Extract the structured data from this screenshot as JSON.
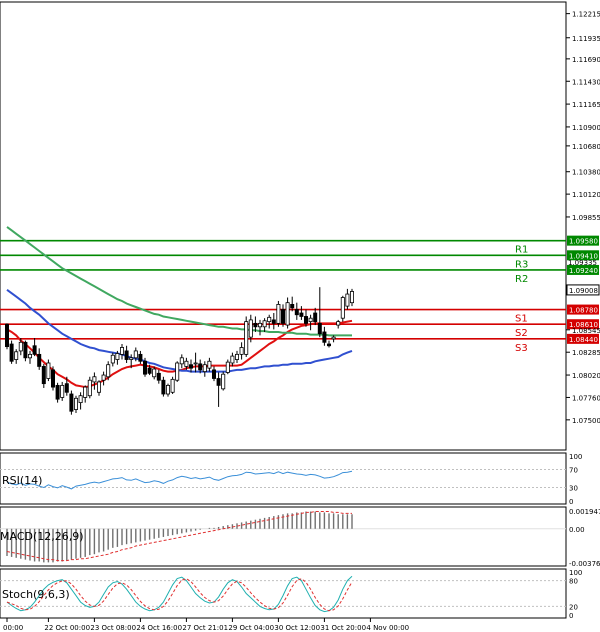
{
  "chart_data": {
    "type": "candlestick",
    "price_axis": {
      "ylim": [
        1.0715,
        1.1235
      ],
      "ticks": [
        "1.12215",
        "1.11935",
        "1.11690",
        "1.11430",
        "1.11165",
        "1.10900",
        "1.10680",
        "1.10380",
        "1.10120",
        "1.09855",
        "1.08545",
        "1.08285",
        "1.08020",
        "1.07760",
        "1.07500"
      ]
    },
    "time_axis": {
      "labels": [
        "00:00",
        "22 Oct 00:00",
        "23 Oct 08:00",
        "24 Oct 16:00",
        "27 Oct 21:01",
        "29 Oct 04:00",
        "30 Oct 12:00",
        "31 Oct 20:00",
        "4 Nov 00:00"
      ],
      "label_bars": [
        0,
        9,
        19,
        29,
        39,
        49,
        59,
        69,
        79
      ]
    },
    "candles": [
      [
        1.0861,
        1.0862,
        1.0832,
        1.0835
      ],
      [
        1.0838,
        1.0842,
        1.0815,
        1.0818
      ],
      [
        1.082,
        1.0832,
        1.0815,
        1.0829
      ],
      [
        1.083,
        1.0845,
        1.0825,
        1.084
      ],
      [
        1.084,
        1.0842,
        1.0818,
        1.0822
      ],
      [
        1.0822,
        1.083,
        1.0815,
        1.0826
      ],
      [
        1.0836,
        1.0845,
        1.0824,
        1.0826
      ],
      [
        1.0826,
        1.0833,
        1.0808,
        1.0812
      ],
      [
        1.0812,
        1.0815,
        1.0787,
        1.0792
      ],
      [
        1.0798,
        1.082,
        1.0795,
        1.0816
      ],
      [
        1.0808,
        1.0812,
        1.0784,
        1.0788
      ],
      [
        1.079,
        1.0793,
        1.077,
        1.0774
      ],
      [
        1.0776,
        1.0794,
        1.0772,
        1.079
      ],
      [
        1.0792,
        1.08,
        1.0778,
        1.0782
      ],
      [
        1.078,
        1.0784,
        1.0756,
        1.076
      ],
      [
        1.0762,
        1.0778,
        1.0758,
        1.0775
      ],
      [
        1.077,
        1.0782,
        1.0762,
        1.0778
      ],
      [
        1.0776,
        1.079,
        1.077,
        1.0788
      ],
      [
        1.0778,
        1.08,
        1.0775,
        1.0796
      ],
      [
        1.0794,
        1.0805,
        1.0785,
        1.08
      ],
      [
        1.0782,
        1.0796,
        1.0778,
        1.0794
      ],
      [
        1.0796,
        1.0806,
        1.079,
        1.0802
      ],
      [
        1.08,
        1.0818,
        1.0796,
        1.0814
      ],
      [
        1.0816,
        1.0828,
        1.0812,
        1.0825
      ],
      [
        1.082,
        1.083,
        1.0814,
        1.0827
      ],
      [
        1.0826,
        1.0838,
        1.082,
        1.0834
      ],
      [
        1.083,
        1.0836,
        1.0816,
        1.082
      ],
      [
        1.082,
        1.0826,
        1.081,
        1.0822
      ],
      [
        1.0822,
        1.0834,
        1.0818,
        1.083
      ],
      [
        1.0826,
        1.083,
        1.0815,
        1.0818
      ],
      [
        1.0818,
        1.0822,
        1.08,
        1.0803
      ],
      [
        1.081,
        1.0814,
        1.0802,
        1.0804
      ],
      [
        1.08,
        1.0812,
        1.0797,
        1.0809
      ],
      [
        1.0804,
        1.0808,
        1.0792,
        1.0796
      ],
      [
        1.0796,
        1.08,
        1.0777,
        1.078
      ],
      [
        1.078,
        1.0792,
        1.0777,
        1.079
      ],
      [
        1.0782,
        1.08,
        1.078,
        1.0797
      ],
      [
        1.0796,
        1.0818,
        1.0794,
        1.0816
      ],
      [
        1.0815,
        1.0826,
        1.081,
        1.0822
      ],
      [
        1.0812,
        1.0822,
        1.0808,
        1.0818
      ],
      [
        1.0814,
        1.082,
        1.0805,
        1.081
      ],
      [
        1.0815,
        1.0828,
        1.0805,
        1.0816
      ],
      [
        1.0815,
        1.082,
        1.0804,
        1.0808
      ],
      [
        1.0806,
        1.0818,
        1.08,
        1.0814
      ],
      [
        1.081,
        1.0822,
        1.0806,
        1.0818
      ],
      [
        1.0808,
        1.0812,
        1.0795,
        1.0798
      ],
      [
        1.0798,
        1.0805,
        1.0765,
        1.079
      ],
      [
        1.0786,
        1.0806,
        1.0784,
        1.0803
      ],
      [
        1.0805,
        1.082,
        1.0803,
        1.0817
      ],
      [
        1.0816,
        1.0828,
        1.0812,
        1.0824
      ],
      [
        1.082,
        1.083,
        1.0816,
        1.0826
      ],
      [
        1.0826,
        1.084,
        1.082,
        1.0834
      ],
      [
        1.0826,
        1.087,
        1.0823,
        1.0864
      ],
      [
        1.0846,
        1.0872,
        1.084,
        1.0866
      ],
      [
        1.0862,
        1.087,
        1.0852,
        1.0858
      ],
      [
        1.0858,
        1.0866,
        1.0848,
        1.0862
      ],
      [
        1.0858,
        1.0868,
        1.0852,
        1.0865
      ],
      [
        1.0864,
        1.0872,
        1.0856,
        1.0869
      ],
      [
        1.0866,
        1.0874,
        1.0855,
        1.0862
      ],
      [
        1.0862,
        1.0888,
        1.0858,
        1.0884
      ],
      [
        1.0878,
        1.0884,
        1.0858,
        1.0862
      ],
      [
        1.086,
        1.0892,
        1.0856,
        1.0886
      ],
      [
        1.0884,
        1.0893,
        1.0876,
        1.088
      ],
      [
        1.0878,
        1.0886,
        1.0866,
        1.0872
      ],
      [
        1.0874,
        1.0882,
        1.0866,
        1.087
      ],
      [
        1.087,
        1.0878,
        1.0858,
        1.0862
      ],
      [
        1.0864,
        1.0872,
        1.0854,
        1.0868
      ],
      [
        1.0874,
        1.088,
        1.086,
        1.0864
      ],
      [
        1.0862,
        1.0904,
        1.0846,
        1.085
      ],
      [
        1.0852,
        1.0858,
        1.0836,
        1.084
      ],
      [
        1.0838,
        1.0842,
        1.0834,
        1.0836
      ],
      [
        1.0844,
        1.0848,
        1.084,
        1.0846
      ],
      [
        1.086,
        1.0866,
        1.0856,
        1.0864
      ],
      [
        1.0868,
        1.0894,
        1.0864,
        1.0892
      ],
      [
        1.0882,
        1.0902,
        1.0878,
        1.0896
      ],
      [
        1.0886,
        1.0902,
        1.0882,
        1.0899
      ]
    ],
    "levels": [
      {
        "label": "R3",
        "value": 1.0941,
        "tag": "1.09410",
        "color": "#008800"
      },
      {
        "label": "R2",
        "value": 1.0924,
        "tag": "1.09240",
        "color": "#008800"
      },
      {
        "label": "R1",
        "value": 1.0958,
        "tag": "1.09580",
        "color": "#008800"
      },
      {
        "label": "S1",
        "value": 1.0878,
        "tag": "1.08780",
        "color": "#d40000"
      },
      {
        "label": "S2",
        "value": 1.0861,
        "tag": "1.08610",
        "color": "#d40000"
      },
      {
        "label": "S3",
        "value": 1.0844,
        "tag": "1.08440",
        "color": "#d40000"
      }
    ],
    "extra_tags": [
      "1.09335",
      "1.09020"
    ],
    "current_price": "1.09008",
    "moving_averages": [
      {
        "color": "#e01010",
        "values": [
          1.0855,
          1.0852,
          1.0848,
          1.0842,
          1.0838,
          1.0833,
          1.0828,
          1.0822,
          1.0817,
          1.0812,
          1.0808,
          1.0803,
          1.08,
          1.0797,
          1.0793,
          1.079,
          1.0789,
          1.0788,
          1.0789,
          1.0791,
          1.0793,
          1.0796,
          1.0799,
          1.0803,
          1.0806,
          1.0809,
          1.0811,
          1.0812,
          1.0813,
          1.0814,
          1.0813,
          1.0812,
          1.0811,
          1.0809,
          1.0807,
          1.0806,
          1.0806,
          1.0807,
          1.0808,
          1.081,
          1.0811,
          1.0812,
          1.0812,
          1.0812,
          1.0813,
          1.0813,
          1.0813,
          1.0813,
          1.0813,
          1.0813,
          1.0813,
          1.0814,
          1.0818,
          1.0822,
          1.0826,
          1.083,
          1.0834,
          1.0838,
          1.0841,
          1.0845,
          1.0848,
          1.0852,
          1.0855,
          1.0857,
          1.0859,
          1.086,
          1.0861,
          1.0862,
          1.0862,
          1.0862,
          1.0862,
          1.0862,
          1.0862,
          1.0863,
          1.0864,
          1.0865
        ]
      },
      {
        "color": "#3050d0",
        "values": [
          1.0901,
          1.0897,
          1.0893,
          1.0889,
          1.0885,
          1.088,
          1.0876,
          1.0872,
          1.0867,
          1.0862,
          1.0858,
          1.0854,
          1.085,
          1.0847,
          1.0844,
          1.0841,
          1.0838,
          1.0836,
          1.0834,
          1.0833,
          1.0831,
          1.083,
          1.0829,
          1.0828,
          1.0827,
          1.0826,
          1.0824,
          1.0822,
          1.0821,
          1.082,
          1.0818,
          1.0816,
          1.0815,
          1.0813,
          1.0811,
          1.081,
          1.0809,
          1.0808,
          1.0807,
          1.0807,
          1.0806,
          1.0806,
          1.0806,
          1.0806,
          1.0806,
          1.0806,
          1.0806,
          1.0806,
          1.0806,
          1.0807,
          1.0808,
          1.0808,
          1.0809,
          1.081,
          1.081,
          1.0811,
          1.0812,
          1.0812,
          1.0813,
          1.0813,
          1.0814,
          1.0814,
          1.0815,
          1.0815,
          1.0815,
          1.0816,
          1.0816,
          1.0818,
          1.0819,
          1.082,
          1.0821,
          1.0822,
          1.0823,
          1.0826,
          1.0828,
          1.083
        ]
      },
      {
        "color": "#40a860",
        "values": [
          1.0974,
          1.097,
          1.0966,
          1.0962,
          1.0958,
          1.0954,
          1.095,
          1.0946,
          1.0942,
          1.0938,
          1.0934,
          1.093,
          1.0926,
          1.0923,
          1.092,
          1.0917,
          1.0914,
          1.0911,
          1.0908,
          1.0905,
          1.0902,
          1.0899,
          1.0896,
          1.0893,
          1.089,
          1.0888,
          1.0885,
          1.0883,
          1.0881,
          1.0879,
          1.0877,
          1.0875,
          1.0873,
          1.0872,
          1.087,
          1.0869,
          1.0868,
          1.0867,
          1.0866,
          1.0865,
          1.0864,
          1.0863,
          1.0862,
          1.0861,
          1.086,
          1.0859,
          1.0858,
          1.0858,
          1.0857,
          1.0856,
          1.0856,
          1.0855,
          1.0855,
          1.0854,
          1.0854,
          1.0853,
          1.0853,
          1.0852,
          1.0852,
          1.0852,
          1.0851,
          1.0851,
          1.0851,
          1.085,
          1.085,
          1.085,
          1.0849,
          1.0849,
          1.0849,
          1.0849,
          1.0848,
          1.0848,
          1.0848,
          1.0848,
          1.0848,
          1.0848
        ]
      }
    ],
    "rsi": {
      "label": "RSI(14)",
      "ticks": [
        "100",
        "70",
        "30",
        "0"
      ],
      "values": [
        42,
        38,
        36,
        40,
        35,
        38,
        37,
        33,
        30,
        36,
        32,
        29,
        34,
        31,
        27,
        33,
        35,
        37,
        40,
        42,
        40,
        43,
        46,
        49,
        50,
        52,
        47,
        46,
        49,
        45,
        41,
        42,
        45,
        43,
        39,
        44,
        47,
        52,
        55,
        53,
        50,
        52,
        49,
        51,
        53,
        48,
        46,
        50,
        54,
        56,
        57,
        59,
        64,
        63,
        60,
        61,
        62,
        63,
        61,
        65,
        61,
        64,
        62,
        60,
        59,
        57,
        59,
        58,
        55,
        51,
        52,
        54,
        58,
        63,
        64,
        66
      ]
    },
    "macd": {
      "label": "MACD(12,26,9)",
      "ticks": [
        "0.001947",
        "0.00",
        "-0.003763"
      ],
      "histogram": [
        -0.003,
        -0.0031,
        -0.0032,
        -0.0033,
        -0.0034,
        -0.0035,
        -0.0036,
        -0.0036,
        -0.0037,
        -0.0037,
        -0.0037,
        -0.0036,
        -0.0036,
        -0.0035,
        -0.0034,
        -0.0033,
        -0.0032,
        -0.0031,
        -0.0029,
        -0.0028,
        -0.0026,
        -0.0025,
        -0.0023,
        -0.0021,
        -0.002,
        -0.0018,
        -0.0017,
        -0.0016,
        -0.0015,
        -0.0014,
        -0.0013,
        -0.0012,
        -0.0011,
        -0.001,
        -0.0009,
        -0.0008,
        -0.0007,
        -0.0006,
        -0.0005,
        -0.0004,
        -0.0003,
        -0.0002,
        -0.0001,
        0.0,
        0.0001,
        0.0001,
        0.0002,
        0.0003,
        0.0004,
        0.0005,
        0.0006,
        0.0007,
        0.0008,
        0.0009,
        0.001,
        0.0011,
        0.0012,
        0.0013,
        0.0014,
        0.0015,
        0.0016,
        0.0017,
        0.0017,
        0.0018,
        0.0018,
        0.0019,
        0.0019,
        0.0019,
        0.0018,
        0.0018,
        0.0017,
        0.0017,
        0.0016,
        0.0016,
        0.0016,
        0.0016
      ],
      "signal": [
        -0.0025,
        -0.0026,
        -0.0027,
        -0.0028,
        -0.0029,
        -0.003,
        -0.0031,
        -0.0032,
        -0.0033,
        -0.0034,
        -0.0034,
        -0.0035,
        -0.0035,
        -0.0035,
        -0.0034,
        -0.0034,
        -0.0033,
        -0.0033,
        -0.0032,
        -0.0031,
        -0.003,
        -0.0029,
        -0.0028,
        -0.0026,
        -0.0025,
        -0.0023,
        -0.0022,
        -0.0021,
        -0.0019,
        -0.0018,
        -0.0017,
        -0.0016,
        -0.0015,
        -0.0014,
        -0.0013,
        -0.0012,
        -0.0011,
        -0.001,
        -0.0009,
        -0.0008,
        -0.0007,
        -0.0006,
        -0.0005,
        -0.0004,
        -0.0003,
        -0.0002,
        -0.0001,
        0.0,
        0.0001,
        0.0002,
        0.0003,
        0.0004,
        0.0005,
        0.0006,
        0.0007,
        0.0008,
        0.0009,
        0.001,
        0.0011,
        0.0012,
        0.0013,
        0.0014,
        0.0015,
        0.0016,
        0.0017,
        0.0018,
        0.0018,
        0.0019,
        0.0019,
        0.0019,
        0.0019,
        0.0018,
        0.0018,
        0.0017,
        0.0017,
        0.0017
      ]
    },
    "stoch": {
      "label": "Stoch(9,6,3)",
      "ticks": [
        "100",
        "80",
        "20",
        "0"
      ],
      "main": [
        30,
        22,
        15,
        10,
        12,
        18,
        30,
        45,
        60,
        70,
        76,
        80,
        82,
        75,
        60,
        45,
        30,
        22,
        18,
        20,
        30,
        48,
        65,
        75,
        78,
        72,
        60,
        45,
        30,
        20,
        14,
        10,
        12,
        18,
        30,
        50,
        70,
        85,
        88,
        80,
        65,
        50,
        40,
        32,
        28,
        30,
        42,
        60,
        75,
        82,
        78,
        65,
        50,
        40,
        30,
        20,
        15,
        12,
        14,
        25,
        45,
        68,
        85,
        88,
        80,
        60,
        40,
        22,
        12,
        8,
        10,
        18,
        35,
        60,
        80,
        90
      ]
    }
  }
}
